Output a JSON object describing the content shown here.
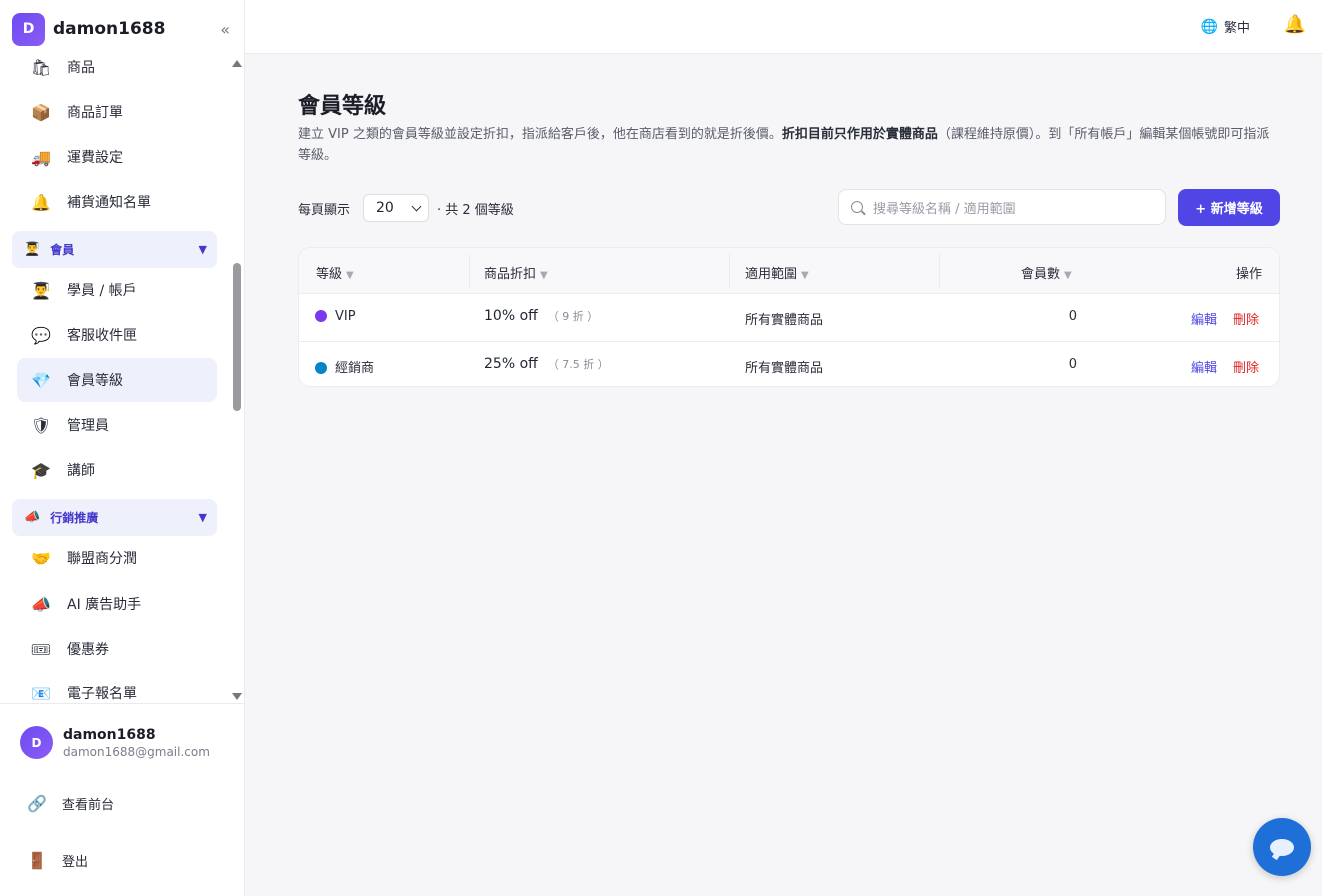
{
  "brand": {
    "initial": "D",
    "name": "damon1688",
    "collapse": "«"
  },
  "nav": {
    "items_top": [
      {
        "label": "商品",
        "icon": "shopping-bag-icon",
        "glyph": "🛍"
      },
      {
        "label": "商品訂單",
        "icon": "package-icon",
        "glyph": "📦"
      },
      {
        "label": "運費設定",
        "icon": "truck-icon",
        "glyph": "🚚"
      },
      {
        "label": "補貨通知名單",
        "icon": "bell-icon",
        "glyph": "🔔"
      }
    ],
    "group_member": {
      "label": "會員",
      "glyph": "👨‍🎓",
      "caret": "▼"
    },
    "items_member": [
      {
        "label": "學員 / 帳戶",
        "icon": "student-icon",
        "glyph": "👨‍🎓"
      },
      {
        "label": "客服收件匣",
        "icon": "speech-bubble-icon",
        "glyph": "💬"
      },
      {
        "label": "會員等級",
        "icon": "diamond-icon",
        "glyph": "💎"
      },
      {
        "label": "管理員",
        "icon": "shield-icon",
        "glyph": "🛡"
      },
      {
        "label": "講師",
        "icon": "graduation-cap-icon",
        "glyph": "🎓"
      }
    ],
    "group_marketing": {
      "label": "行銷推廣",
      "glyph": "📣",
      "caret": "▼"
    },
    "items_marketing": [
      {
        "label": "聯盟商分潤",
        "icon": "handshake-icon",
        "glyph": "🤝"
      },
      {
        "label": "AI 廣告助手",
        "icon": "megaphone-icon",
        "glyph": "📣"
      },
      {
        "label": "優惠券",
        "icon": "ticket-icon",
        "glyph": "🎟"
      },
      {
        "label": "電子報名單",
        "icon": "newsletter-icon",
        "glyph": "📧"
      }
    ]
  },
  "user": {
    "initial": "D",
    "name": "damon1688",
    "email": "damon1688@gmail.com"
  },
  "bottom_links": {
    "storefront": "查看前台",
    "storefront_glyph": "🔗",
    "logout": "登出",
    "logout_glyph": "🚪"
  },
  "topbar": {
    "language": "繁中",
    "globe_glyph": "🌐",
    "bell_glyph": "🔔"
  },
  "page": {
    "title": "會員等級",
    "desc_part1": "建立 VIP 之類的會員等級並設定折扣，指派給客戶後，他在商店看到的就是折後價。",
    "desc_bold": "折扣目前只作用於實體商品",
    "desc_part2": "（課程維持原價）。到「所有帳戶」編輯某個帳號即可指派等級。"
  },
  "toolbar": {
    "per_page_label": "每頁顯示",
    "per_page_value": "20",
    "total": "· 共 2 個等級",
    "search_placeholder": "搜尋等級名稱 / 適用範圍",
    "add_button": "+ 新增等級"
  },
  "table": {
    "headers": {
      "level": "等級",
      "discount": "商品折扣",
      "scope": "適用範圍",
      "members": "會員數",
      "actions": "操作"
    },
    "sort_glyph": "▼",
    "rows": [
      {
        "name": "VIP",
        "color": "#7c3aed",
        "discount": "10% off",
        "discount_note": "（ 9 折 ）",
        "scope": "所有實體商品",
        "members": "0",
        "edit": "編輯",
        "delete": "刪除"
      },
      {
        "name": "經銷商",
        "color": "#0284c7",
        "discount": "25% off",
        "discount_note": "（ 7.5 折 ）",
        "scope": "所有實體商品",
        "members": "0",
        "edit": "編輯",
        "delete": "刪除"
      }
    ]
  },
  "colors": {
    "accent": "#4f46e5",
    "danger": "#dc2626",
    "active_bg": "#eef0fc"
  }
}
